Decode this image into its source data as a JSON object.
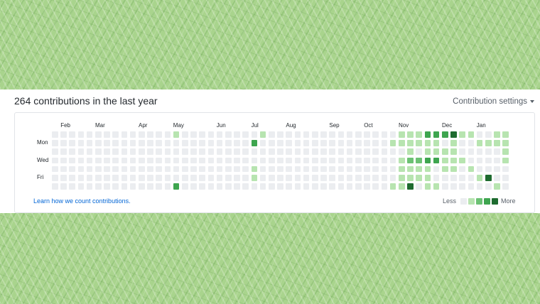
{
  "header": {
    "title": "264 contributions in the last year",
    "settings_label": "Contribution settings"
  },
  "graph": {
    "months": [
      {
        "label": "Feb",
        "week": 1
      },
      {
        "label": "Mar",
        "week": 5
      },
      {
        "label": "Apr",
        "week": 10
      },
      {
        "label": "May",
        "week": 14
      },
      {
        "label": "Jun",
        "week": 19
      },
      {
        "label": "Jul",
        "week": 23
      },
      {
        "label": "Aug",
        "week": 27
      },
      {
        "label": "Sep",
        "week": 32
      },
      {
        "label": "Oct",
        "week": 36
      },
      {
        "label": "Nov",
        "week": 40
      },
      {
        "label": "Dec",
        "week": 45
      },
      {
        "label": "Jan",
        "week": 49
      }
    ],
    "day_labels": [
      {
        "label": "Mon",
        "row": 1
      },
      {
        "label": "Wed",
        "row": 3
      },
      {
        "label": "Fri",
        "row": 5
      }
    ],
    "weeks": 53,
    "levels": [
      "0000000000000000000000000000000000000000000000000000000000000000000000000000000000000000000000000000000000000000000000000000000000000000000000000000000000000000",
      "00000000000000000000000000000000000000000000000000000000000000000000000000000000000000000000000000000000000000000000000000000000000000000000000000000000000000000000",
      "0000000000000000000000000000000000000000000000000000000000000000000000000000000000000000000000000000000000000000000000000000000000000000000000000000000000",
      "0000000000000000000000000000000000000000000000000000000000000000000000000000000000000000000000000000000000000000000000000000000000000000000000000000000000000000000",
      "00000000000000000000000000000000000000000000000000000000000000000000000000000000000000000000000000000000000000000000000000000000000000000000000000000000000000000000",
      "0000000000000000000000000000000000000000000000000000000000000000000000000000000000000000000000000000000000000000000000000000000000000000000000000000000000000000000000",
      "0000000000000000000000000000000000000000000000000000000000000000000000000000000000000000000000000000000000000000000000000000000000000000000000000000000000000000000000000000"
    ],
    "rows": [
      "00000000000000100000000010000000000000001113334110011",
      "00000000000000000000000300000000000000011111101001111",
      "00000000000000000000000000000000000000000101111000001",
      "00000000000000000000000000000000000000001223311100001",
      "00000000000000000000000100000000000000001111011010000",
      "00000000000000000000000100000000000000001111000001400",
      "00000000000000300000000000000000000000011401100000010"
    ],
    "colors": [
      "#ebedf0",
      "#9be9a8",
      "#40c463",
      "#30a14e",
      "#216e39"
    ],
    "level_colors_rendered": [
      "#ebedf0",
      "#b7e4b0",
      "#6cc174",
      "#3ea54f",
      "#1e6b2f"
    ]
  },
  "footer": {
    "learn_link": "Learn how we count contributions.",
    "legend_less": "Less",
    "legend_more": "More",
    "legend_levels": [
      0,
      1,
      2,
      3,
      4
    ]
  }
}
